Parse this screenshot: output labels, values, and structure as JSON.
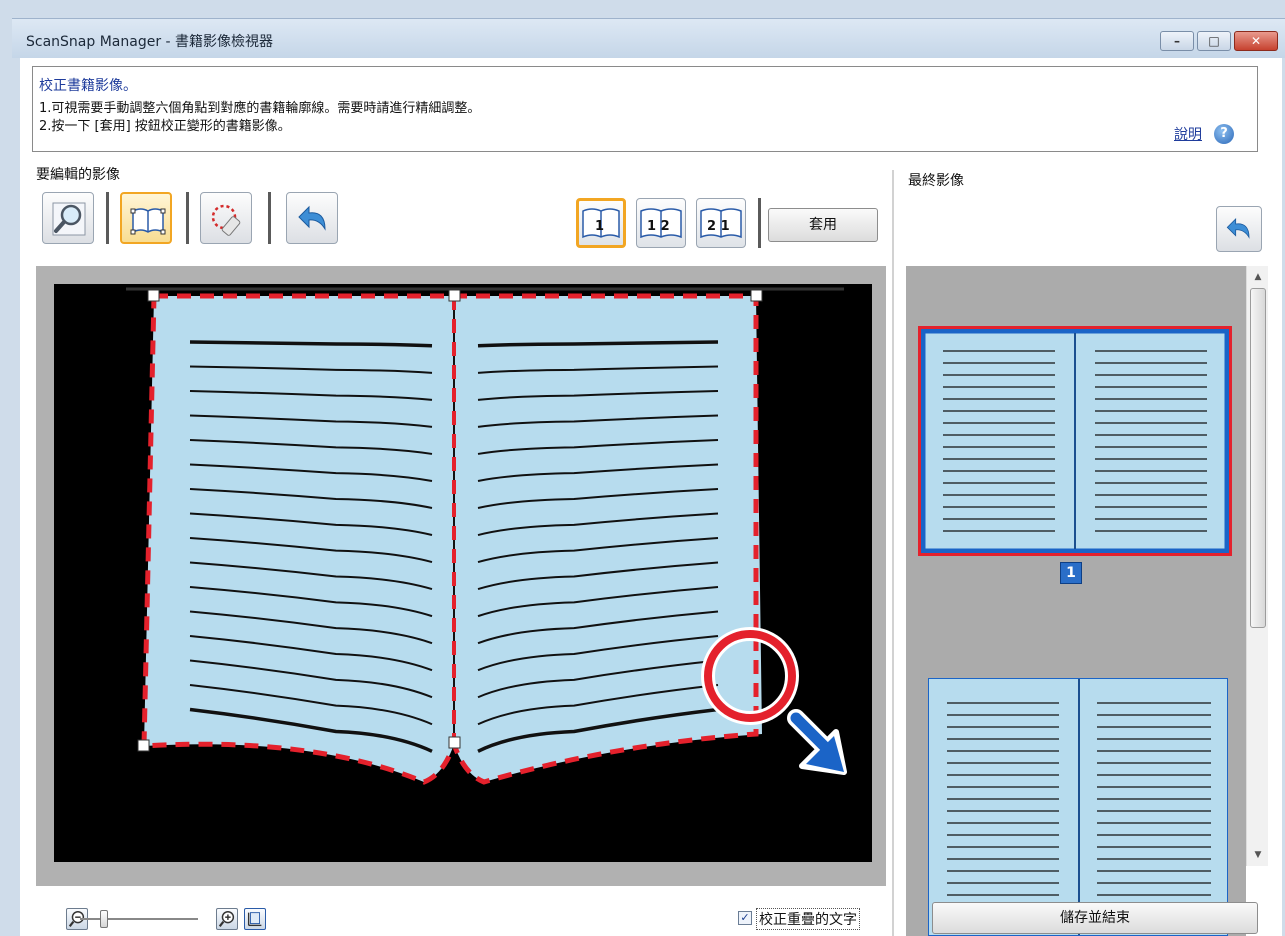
{
  "window": {
    "title": "ScanSnap Manager - 書籍影像檢視器",
    "minimize_glyph": "–",
    "maximize_glyph": "□",
    "close_glyph": "✕"
  },
  "instructions": {
    "title": "校正書籍影像。",
    "line1": "1.可視需要手動調整六個角點到對應的書籍輪廓線。需要時請進行精細調整。",
    "line2": "2.按一下 [套用] 按鈕校正變形的書籍影像。",
    "help_label": "說明",
    "help_icon_glyph": "?"
  },
  "edit_panel": {
    "label": "要編輯的影像",
    "tools": [
      {
        "name": "zoom-tool",
        "icon": "magnifier-icon"
      },
      {
        "name": "point-adjust-tool",
        "icon": "book-corners-icon",
        "selected": true
      },
      {
        "name": "finger-erase-tool",
        "icon": "eraser-icon"
      },
      {
        "name": "undo-tool",
        "icon": "undo-arrow-icon"
      }
    ],
    "layouts": [
      {
        "label": "1",
        "selected": true
      },
      {
        "label": "1 2"
      },
      {
        "label": "2 1"
      }
    ],
    "apply_label": "套用"
  },
  "final_panel": {
    "label": "最終影像",
    "page_number": "1"
  },
  "bottom": {
    "checkbox_checked": true,
    "checkbox_glyph": "✓",
    "checkbox_label": "校正重疊的文字",
    "save_label": "儲存並結束"
  },
  "colors": {
    "accent": "#f2a623",
    "selection": "#e4212c",
    "page_fill": "#b7dcee",
    "arrow": "#1b64c7"
  }
}
